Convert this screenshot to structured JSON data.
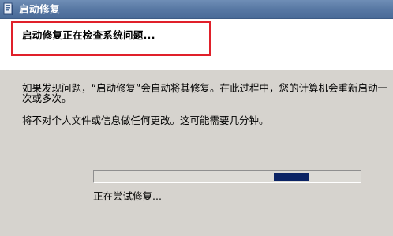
{
  "window": {
    "title": "启动修复",
    "icon": "startup-repair-icon"
  },
  "header": {
    "heading": "启动修复正在检查系统问题..."
  },
  "body": {
    "description": "如果发现问题，“启动修复”会自动将其修复。在此过程中，您的计算机会重新启动一次或多次。",
    "note": "将不对个人文件或信息做任何更改。这可能需要几分钟。"
  },
  "progress": {
    "mode": "marquee",
    "status_text": "正在尝试修复...",
    "bar_color": "#0b2364"
  },
  "colors": {
    "titlebar": "#5a7aa5",
    "highlight": "#e0202a",
    "panel_background": "#d6d3ce"
  }
}
